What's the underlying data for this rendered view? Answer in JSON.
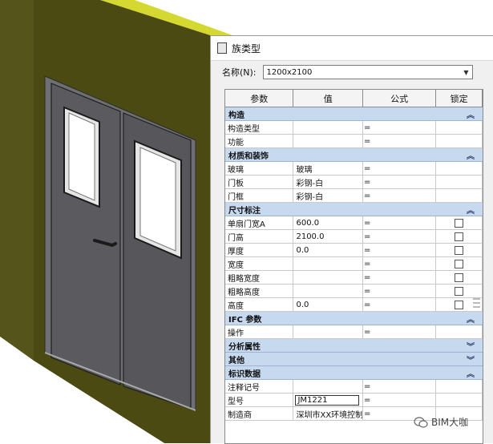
{
  "dialog": {
    "title": "族类型",
    "name_label": "名称(N):",
    "name_value": "1200x2100"
  },
  "table": {
    "columns": [
      "参数",
      "值",
      "公式",
      "锁定"
    ],
    "groups": [
      {
        "name": "构造",
        "expanded": true,
        "rows": [
          {
            "param": "构造类型",
            "value": "",
            "formula": "=",
            "lock": false
          },
          {
            "param": "功能",
            "value": "",
            "formula": "=",
            "lock": false
          }
        ]
      },
      {
        "name": "材质和装饰",
        "expanded": true,
        "rows": [
          {
            "param": "玻璃",
            "value": "玻璃",
            "formula": "=",
            "lock": false
          },
          {
            "param": "门板",
            "value": "彩钢-白",
            "formula": "=",
            "lock": false
          },
          {
            "param": "门框",
            "value": "彩钢-白",
            "formula": "=",
            "lock": false
          }
        ]
      },
      {
        "name": "尺寸标注",
        "expanded": true,
        "rows": [
          {
            "param": "单扇门宽A",
            "value": "600.0",
            "formula": "=",
            "lock": true
          },
          {
            "param": "门高",
            "value": "2100.0",
            "formula": "=",
            "lock": true
          },
          {
            "param": "厚度",
            "value": "0.0",
            "formula": "=",
            "lock": true
          },
          {
            "param": "宽度",
            "value": "",
            "formula": "=",
            "lock": true
          },
          {
            "param": "粗略宽度",
            "value": "",
            "formula": "=",
            "lock": true
          },
          {
            "param": "粗略高度",
            "value": "",
            "formula": "=",
            "lock": true
          },
          {
            "param": "高度",
            "value": "0.0",
            "formula": "=",
            "lock": true
          }
        ]
      },
      {
        "name": "IFC 参数",
        "expanded": true,
        "rows": [
          {
            "param": "操作",
            "value": "",
            "formula": "=",
            "lock": false
          }
        ]
      },
      {
        "name": "分析属性",
        "expanded": false,
        "rows": []
      },
      {
        "name": "其他",
        "expanded": false,
        "rows": []
      },
      {
        "name": "标识数据",
        "expanded": true,
        "rows": [
          {
            "param": "注释记号",
            "value": "",
            "formula": "=",
            "lock": false
          },
          {
            "param": "型号",
            "value": "JM1221",
            "formula": "=",
            "lock": false,
            "editing": true
          },
          {
            "param": "制造商",
            "value": "深圳市XX环境控制",
            "formula": "=",
            "lock": false
          }
        ]
      }
    ]
  },
  "icons": {
    "expand": "chevron-up-icon",
    "collapse": "chevron-down-icon",
    "dropdown": "chevron-down-icon",
    "watermark": "wechat-icon"
  },
  "watermark": {
    "text": "BIM大咖"
  },
  "colors": {
    "wall": "#4b4a13",
    "wall_edge": "#d6d832",
    "door": "#5a5a5f",
    "group_header": "#c7d9ef"
  }
}
